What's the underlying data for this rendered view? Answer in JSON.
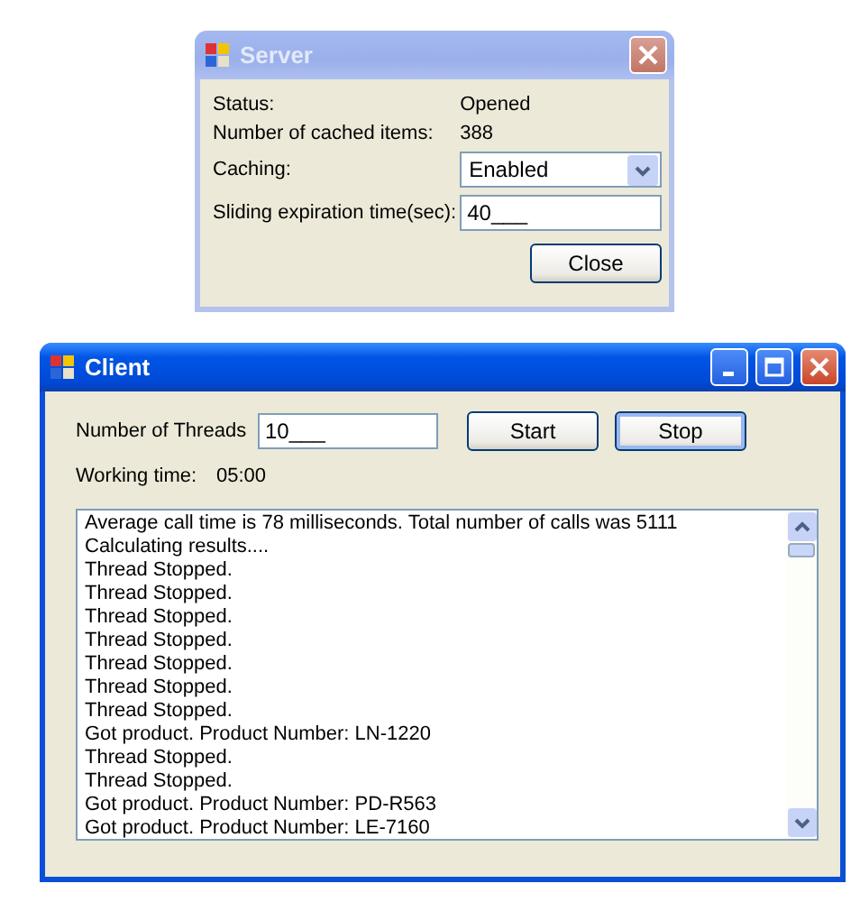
{
  "server": {
    "title": "Server",
    "status_label": "Status:",
    "status_value": "Opened",
    "cached_label": "Number of cached items:",
    "cached_value": "388",
    "caching_label": "Caching:",
    "caching_value": "Enabled",
    "expiration_label": "Sliding expiration time(sec):",
    "expiration_value": "40___",
    "close_button": "Close"
  },
  "client": {
    "title": "Client",
    "threads_label": "Number of Threads",
    "threads_value": "10___",
    "buttons": [
      "Start",
      "Stop"
    ],
    "working_label": "Working time:",
    "working_value": "05:00",
    "log": [
      "Average call time is 78 milliseconds. Total number of calls was 5111",
      "Calculating results....",
      "Thread Stopped.",
      "Thread Stopped.",
      "Thread Stopped.",
      "Thread Stopped.",
      "Thread Stopped.",
      "Thread Stopped.",
      "Thread Stopped.",
      "Got product. Product Number: LN-1220",
      "Thread Stopped.",
      "Thread Stopped.",
      "Got product. Product Number: PD-R563",
      "Got product. Product Number: LE-7160"
    ]
  }
}
